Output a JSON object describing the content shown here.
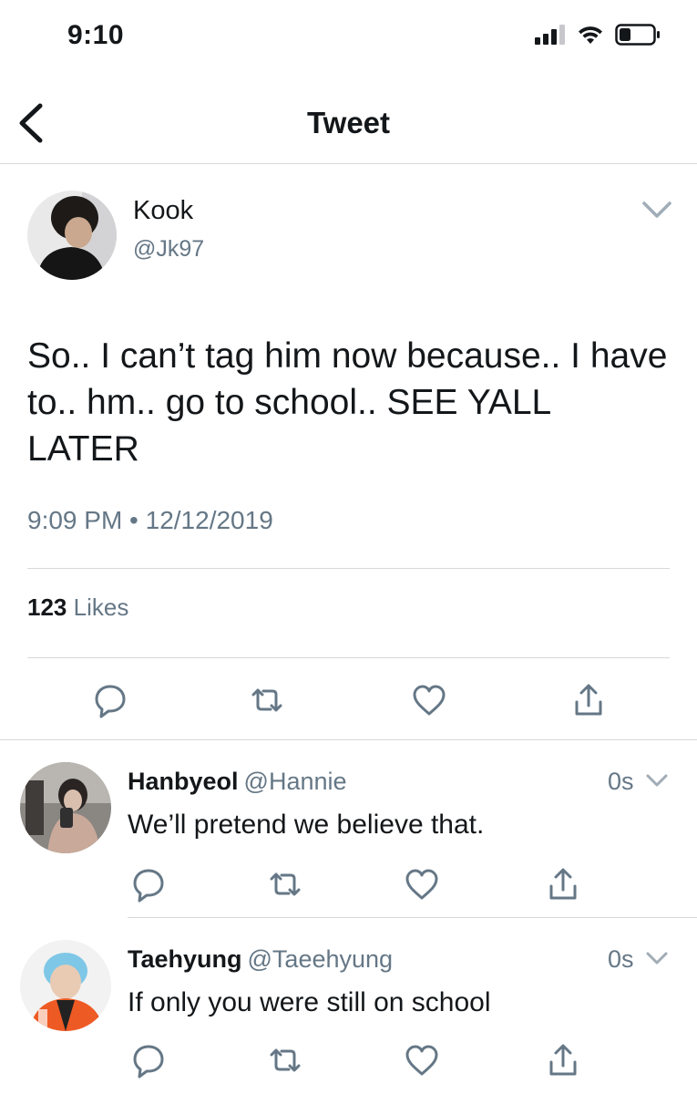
{
  "status_bar": {
    "time": "9:10"
  },
  "nav": {
    "title": "Tweet"
  },
  "main_tweet": {
    "name": "Kook",
    "handle": "@Jk97",
    "text": "So.. I can’t tag him now because.. I have to.. hm.. go to school.. SEE YALL LATER",
    "meta": "9:09 PM • 12/12/2019",
    "likes_count": "123",
    "likes_label": "Likes"
  },
  "replies": [
    {
      "name": "Hanbyeol",
      "handle": "@Hannie",
      "time": "0s",
      "text": "We’ll pretend we believe that."
    },
    {
      "name": "Taehyung",
      "handle": "@Taeehyung",
      "time": "0s",
      "text": "If only you were still on school"
    }
  ],
  "icons": {
    "reply": "reply-icon",
    "retweet": "retweet-icon",
    "like": "heart-icon",
    "share": "share-icon",
    "more": "chevron-down-icon"
  },
  "colors": {
    "secondary_text": "#657786",
    "divider": "#d6d9db",
    "icon": "#657786"
  }
}
